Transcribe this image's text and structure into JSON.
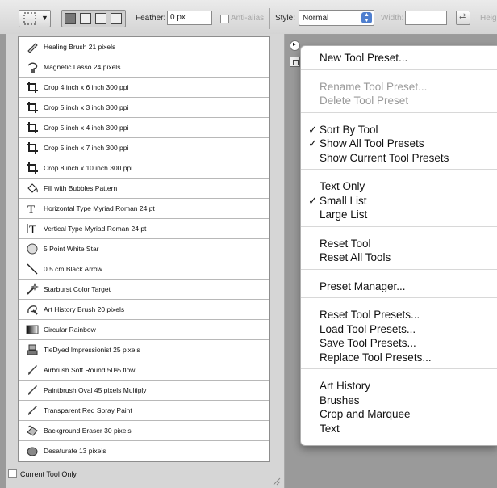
{
  "options_bar": {
    "feather_label": "Feather:",
    "feather_value": "0 px",
    "antialias_label": "Anti-alias",
    "style_label": "Style:",
    "style_value": "Normal",
    "width_label": "Width:",
    "width_value": "",
    "height_label": "Heig"
  },
  "presets": [
    {
      "label": "Healing Brush 21 pixels",
      "icon": "healing-brush-icon"
    },
    {
      "label": "Magnetic Lasso 24 pixels",
      "icon": "magnetic-lasso-icon"
    },
    {
      "label": "Crop 4 inch x 6 inch 300 ppi",
      "icon": "crop-icon"
    },
    {
      "label": "Crop 5 inch x 3 inch 300 ppi",
      "icon": "crop-icon"
    },
    {
      "label": "Crop 5 inch x 4 inch 300 ppi",
      "icon": "crop-icon"
    },
    {
      "label": "Crop 5 inch x 7 inch 300 ppi",
      "icon": "crop-icon"
    },
    {
      "label": "Crop 8 inch x 10 inch 300 ppi",
      "icon": "crop-icon"
    },
    {
      "label": "Fill with Bubbles Pattern",
      "icon": "paint-bucket-icon"
    },
    {
      "label": "Horizontal Type Myriad Roman 24 pt",
      "icon": "horizontal-type-icon"
    },
    {
      "label": "Vertical Type Myriad Roman 24 pt",
      "icon": "vertical-type-icon"
    },
    {
      "label": "5 Point White Star",
      "icon": "custom-shape-icon"
    },
    {
      "label": "0.5 cm Black Arrow",
      "icon": "line-icon"
    },
    {
      "label": "Starburst Color Target",
      "icon": "magic-wand-icon"
    },
    {
      "label": "Art History Brush 20 pixels",
      "icon": "art-history-brush-icon"
    },
    {
      "label": "Circular Rainbow",
      "icon": "gradient-icon"
    },
    {
      "label": "TieDyed Impressionist 25 pixels",
      "icon": "pattern-stamp-icon"
    },
    {
      "label": "Airbrush Soft Round 50% flow",
      "icon": "brush-icon"
    },
    {
      "label": "Paintbrush Oval 45 pixels Multiply",
      "icon": "brush-icon"
    },
    {
      "label": "Transparent Red Spray Paint",
      "icon": "brush-icon"
    },
    {
      "label": "Background Eraser 30 pixels",
      "icon": "background-eraser-icon"
    },
    {
      "label": "Desaturate 13 pixels",
      "icon": "sponge-icon"
    }
  ],
  "current_tool_only_label": "Current Tool Only",
  "menu": {
    "groups": [
      [
        {
          "label": "New Tool Preset...",
          "checked": false,
          "enabled": true
        }
      ],
      [
        {
          "label": "Rename Tool Preset...",
          "checked": false,
          "enabled": false
        },
        {
          "label": "Delete Tool Preset",
          "checked": false,
          "enabled": false
        }
      ],
      [
        {
          "label": "Sort By Tool",
          "checked": true,
          "enabled": true
        },
        {
          "label": "Show All Tool Presets",
          "checked": true,
          "enabled": true
        },
        {
          "label": "Show Current Tool Presets",
          "checked": false,
          "enabled": true
        }
      ],
      [
        {
          "label": "Text Only",
          "checked": false,
          "enabled": true
        },
        {
          "label": "Small List",
          "checked": true,
          "enabled": true
        },
        {
          "label": "Large List",
          "checked": false,
          "enabled": true
        }
      ],
      [
        {
          "label": "Reset Tool",
          "checked": false,
          "enabled": true
        },
        {
          "label": "Reset All Tools",
          "checked": false,
          "enabled": true
        }
      ],
      [
        {
          "label": "Preset Manager...",
          "checked": false,
          "enabled": true
        }
      ],
      [
        {
          "label": "Reset Tool Presets...",
          "checked": false,
          "enabled": true
        },
        {
          "label": "Load Tool Presets...",
          "checked": false,
          "enabled": true
        },
        {
          "label": "Save Tool Presets...",
          "checked": false,
          "enabled": true
        },
        {
          "label": "Replace Tool Presets...",
          "checked": false,
          "enabled": true
        }
      ],
      [
        {
          "label": "Art History",
          "checked": false,
          "enabled": true
        },
        {
          "label": "Brushes",
          "checked": false,
          "enabled": true
        },
        {
          "label": "Crop and Marquee",
          "checked": false,
          "enabled": true
        },
        {
          "label": "Text",
          "checked": false,
          "enabled": true
        }
      ]
    ],
    "check_glyph": "✓"
  }
}
